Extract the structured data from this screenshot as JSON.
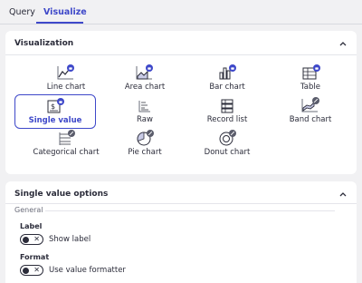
{
  "tabs": [
    {
      "label": "Query",
      "active": false
    },
    {
      "label": "Visualize",
      "active": true
    }
  ],
  "visualization": {
    "title": "Visualization",
    "items": [
      {
        "label": "Line chart",
        "icon": "line-chart-icon",
        "selected": false
      },
      {
        "label": "Area chart",
        "icon": "area-chart-icon",
        "selected": false
      },
      {
        "label": "Bar chart",
        "icon": "bar-chart-icon",
        "selected": false
      },
      {
        "label": "Table",
        "icon": "table-icon",
        "selected": false
      },
      {
        "label": "Single value",
        "icon": "single-value-icon",
        "selected": true
      },
      {
        "label": "Raw",
        "icon": "raw-icon",
        "selected": false
      },
      {
        "label": "Record list",
        "icon": "record-list-icon",
        "selected": false
      },
      {
        "label": "Band chart",
        "icon": "band-chart-icon",
        "selected": false
      },
      {
        "label": "Categorical chart",
        "icon": "categorical-chart-icon",
        "selected": false
      },
      {
        "label": "Pie chart",
        "icon": "pie-chart-icon",
        "selected": false
      },
      {
        "label": "Donut chart",
        "icon": "donut-chart-icon",
        "selected": false
      }
    ]
  },
  "options": {
    "title": "Single value options",
    "section": "General",
    "label_field": {
      "label": "Label",
      "toggle_text": "Show label",
      "enabled": false
    },
    "format_field": {
      "label": "Format",
      "toggle_text": "Use value formatter",
      "enabled": false
    }
  },
  "colors": {
    "accent": "#3e48c9",
    "badge_enabled": "#3e48c9",
    "badge_disabled": "#5a5c6b"
  }
}
